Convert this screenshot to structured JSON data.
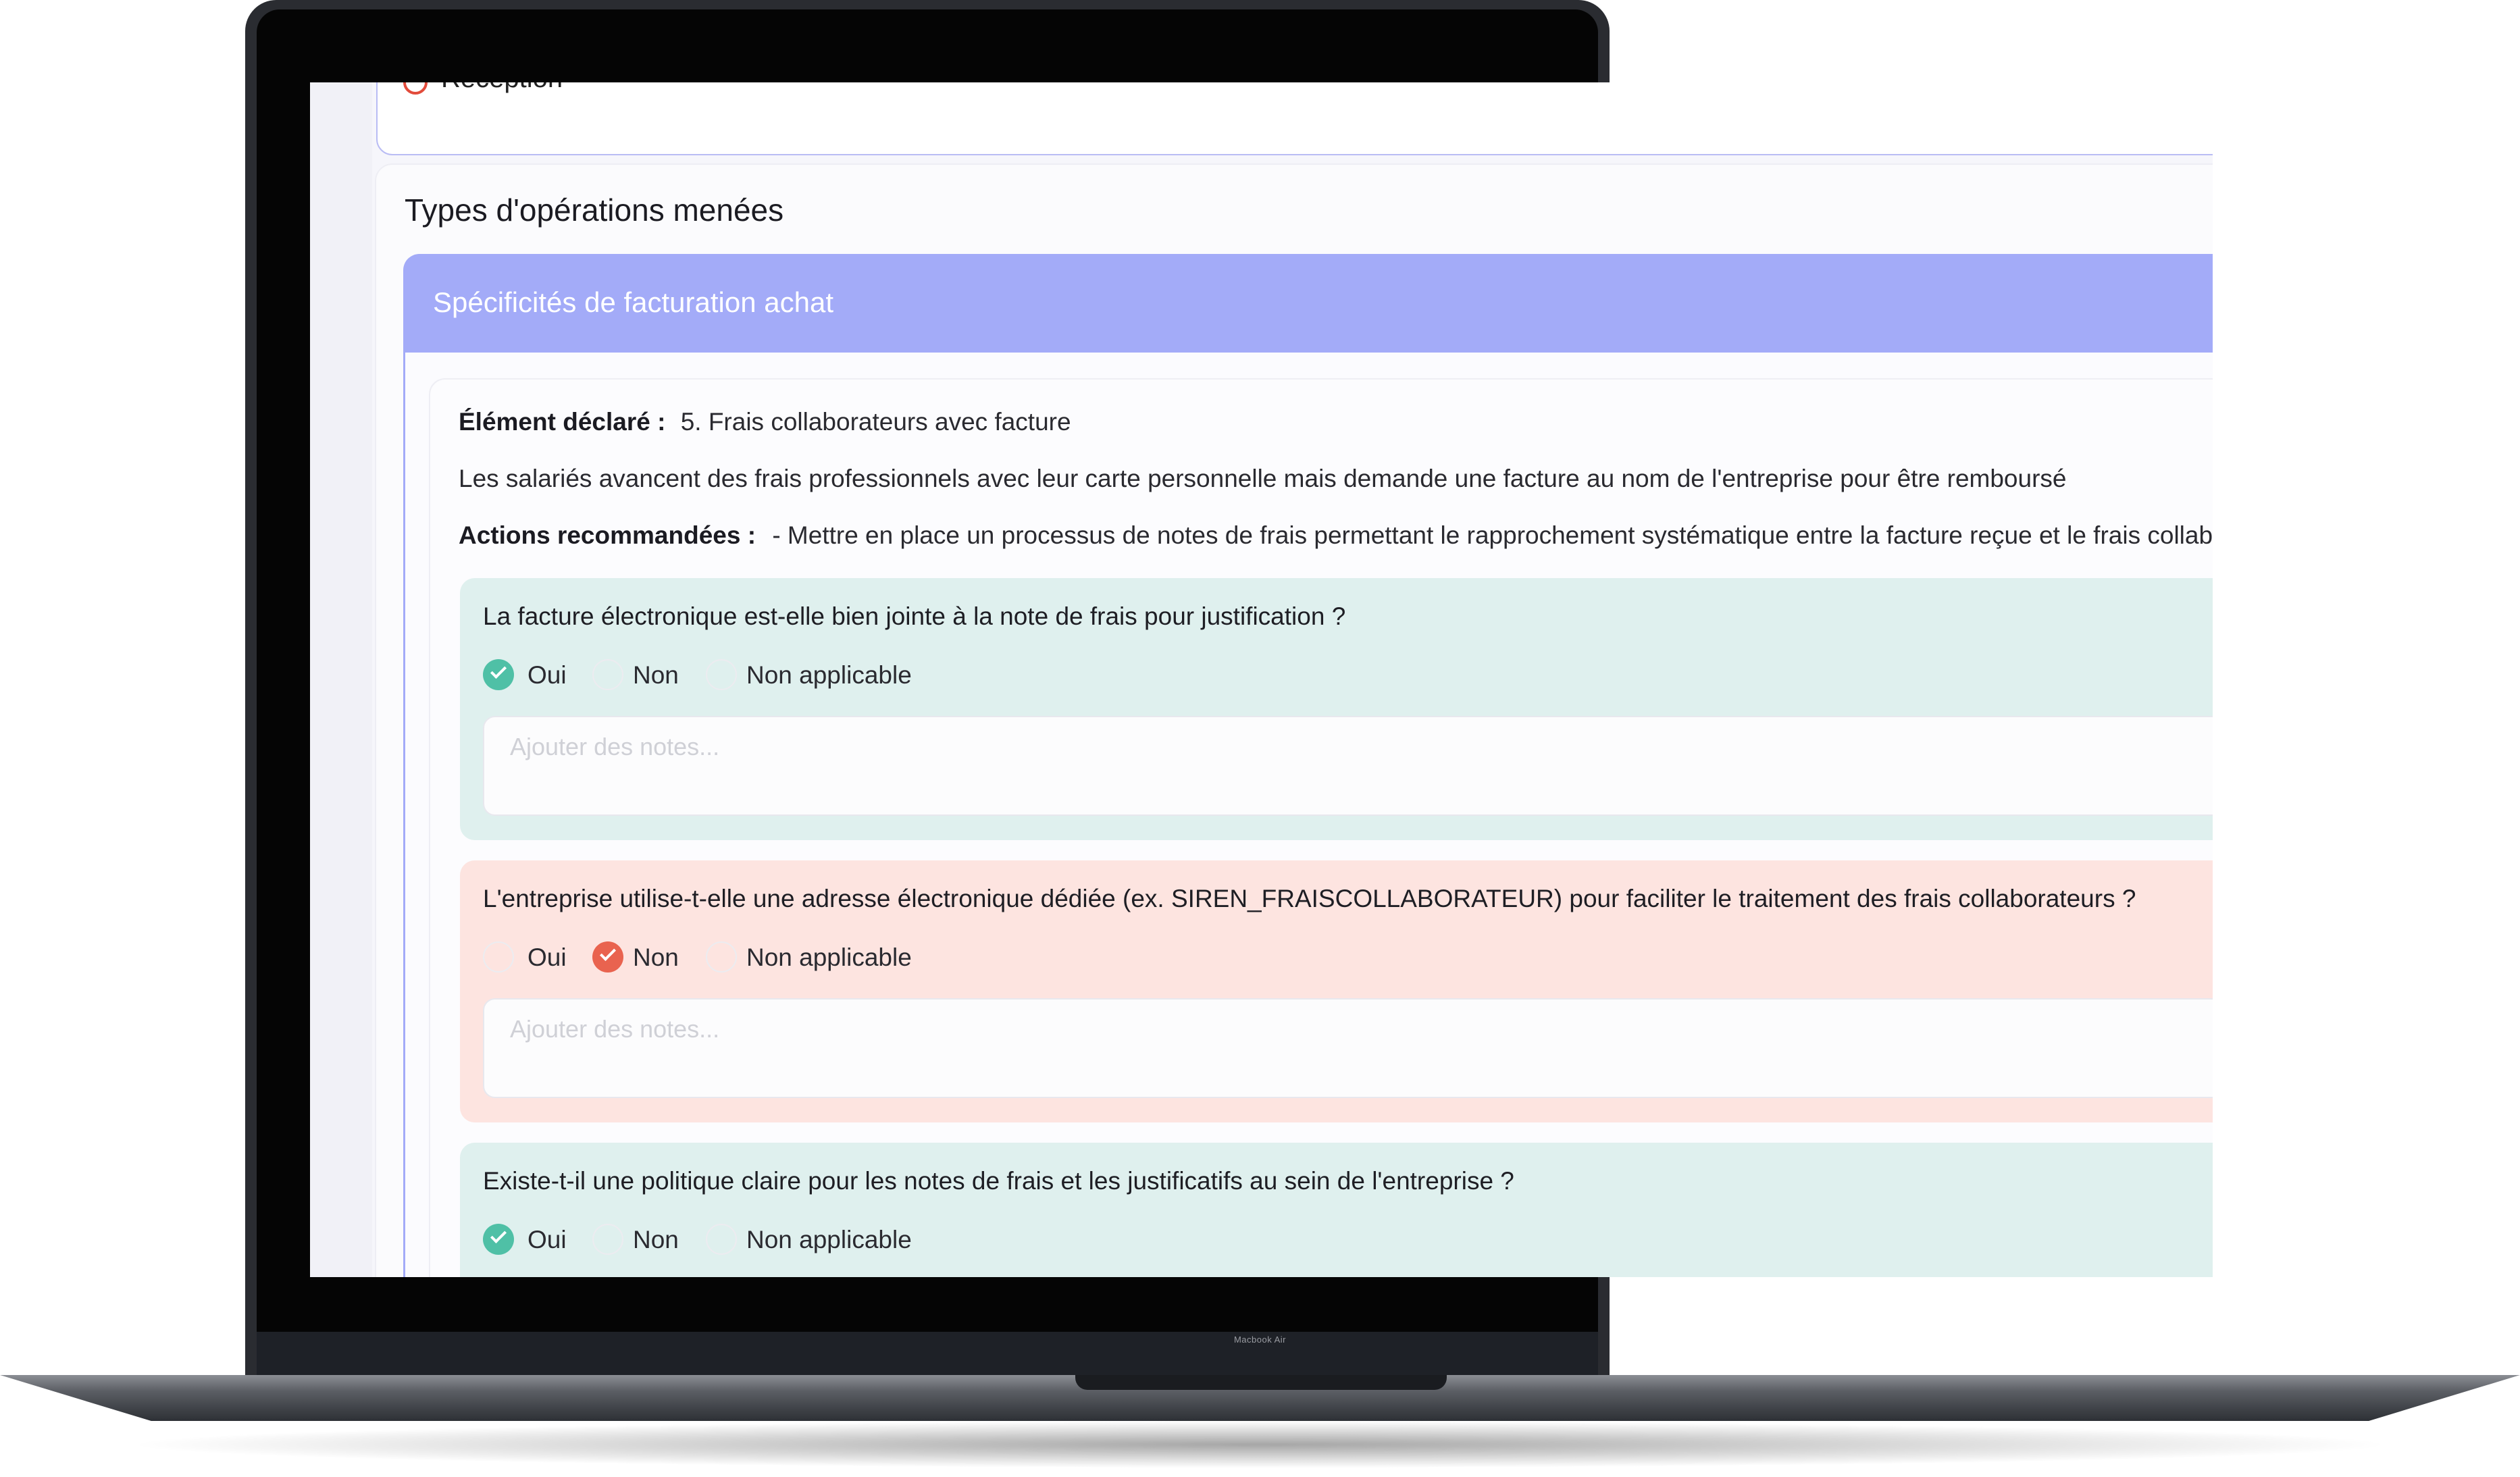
{
  "device": {
    "model_label": "Macbook Air"
  },
  "previous_item": {
    "label": "Réception"
  },
  "section": {
    "title": "Types d'opérations menées"
  },
  "accordion": {
    "title": "Spécificités de facturation achat"
  },
  "declared": {
    "label": "Élément déclaré :",
    "value": "5. Frais collaborateurs avec facture",
    "description": "Les salariés avancent des frais professionnels avec leur carte personnelle mais demande une facture au nom de l'entreprise pour être remboursé",
    "actions_label": "Actions recommandées :",
    "actions_value": "- Mettre en place un processus de notes de frais permettant le rapprochement systématique entre la facture reçue et le frais collabo"
  },
  "options": {
    "yes": "Oui",
    "no": "Non",
    "na": "Non applicable"
  },
  "notes_placeholder": "Ajouter des notes...",
  "questions": [
    {
      "text": "La facture électronique est-elle bien jointe à la note de frais pour justification ?",
      "selected": "Oui",
      "color": "#4fc0a6"
    },
    {
      "text": "L'entreprise utilise-t-elle une adresse électronique dédiée (ex. SIREN_FRAISCOLLABORATEUR) pour faciliter le traitement des frais collaborateurs ?",
      "selected": "Non",
      "color": "#e9634f"
    },
    {
      "text": "Existe-t-il une politique claire pour les notes de frais et les justificatifs au sein de l'entreprise ?",
      "selected": "Oui",
      "color": "#4fc0a6"
    }
  ],
  "colors": {
    "accent": "#a3abf8",
    "positive_bg": "#dff0ee",
    "negative_bg": "#fde4e0"
  }
}
